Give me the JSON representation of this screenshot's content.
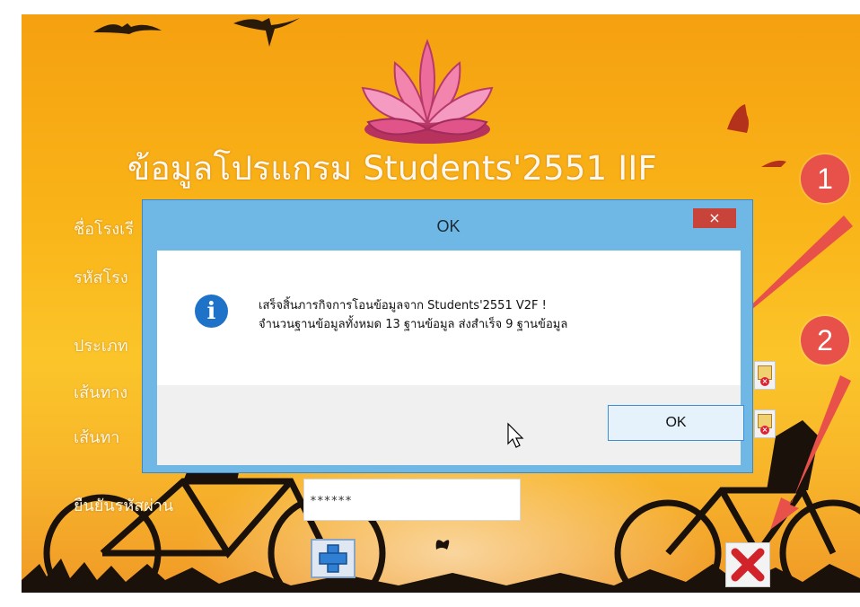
{
  "app": {
    "title": "ข้อมูลโปรแกรม Students'2551 IIF",
    "labels": {
      "school_name": "ชื่อโรงเรี",
      "school_code": "รหัสโรง",
      "type": "ประเภท",
      "path1": "เส้นทาง",
      "path2": "เส้นทา",
      "confirm_password": "ยืนยันรหัสผ่าน"
    },
    "confirm_password_value": "******",
    "icons": {
      "logo": "lotus-logo",
      "add": "plus-icon",
      "close": "red-x-icon",
      "browse": "folder-delete-icon"
    }
  },
  "dialog": {
    "title": "OK",
    "close_glyph": "×",
    "message_line1": "เสร็จสิ้นภารกิจการโอนข้อมูลจาก Students'2551 V2F !",
    "message_line2": "จำนวนฐานข้อมูลทั้งหมด 13 ฐานข้อมูล ส่งสำเร็จ  9 ฐานข้อมูล",
    "ok_label": "OK",
    "info_glyph": "i"
  },
  "annotations": {
    "badge1": "1",
    "badge2": "2"
  },
  "colors": {
    "sky_top": "#f5a010",
    "sky_bottom": "#f09a28",
    "dialog_frame": "#6fb8e6",
    "close_red": "#c8443a",
    "callout_red": "#e8504a",
    "info_blue": "#1e73c8"
  }
}
